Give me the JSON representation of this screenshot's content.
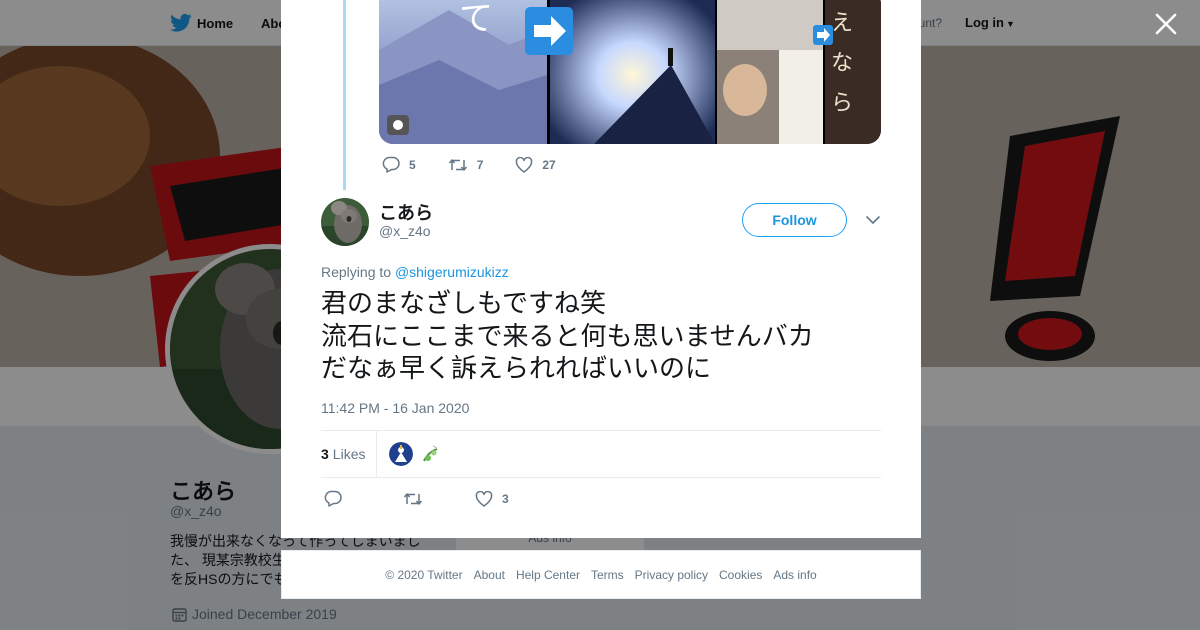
{
  "background_page": {
    "nav_home": "Home",
    "nav_about": "Abo",
    "account_prompt": "ccount?",
    "login": "Log in",
    "profile_name": "こあら",
    "profile_handle": "@x_z4o",
    "bio_lines": [
      "我慢が出来なくなって作ってしまいまし",
      "た、 現某宗教校生",
      "を反HSの方にでも"
    ],
    "joined": "Joined December 2019",
    "ads_info_partial": "Ads info"
  },
  "previous_tweet": {
    "reply_count": "5",
    "retweet_count": "7",
    "like_count": "27"
  },
  "tweet": {
    "display_name": "こあら",
    "handle": "@x_z4o",
    "follow_label": "Follow",
    "replying_prefix": "Replying to",
    "replying_to": "@shigerumizukizz",
    "text_lines": [
      "君のまなざしもですね笑",
      "流石にここまで来ると何も思いませんバカ",
      "だなぁ早く訴えられればいいのに"
    ],
    "timestamp": "11:42 PM - 16 Jan 2020",
    "likes_count": "3",
    "likes_label": "Likes",
    "action_like_count": "3"
  },
  "footer": {
    "copyright": "© 2020 Twitter",
    "links": [
      "About",
      "Help Center",
      "Terms",
      "Privacy policy",
      "Cookies",
      "Ads info"
    ]
  },
  "colors": {
    "accent": "#1da1f2",
    "link": "#1b95e0",
    "text": "#14171a",
    "secondary": "#657786",
    "thread_line": "#a7d8f7"
  }
}
